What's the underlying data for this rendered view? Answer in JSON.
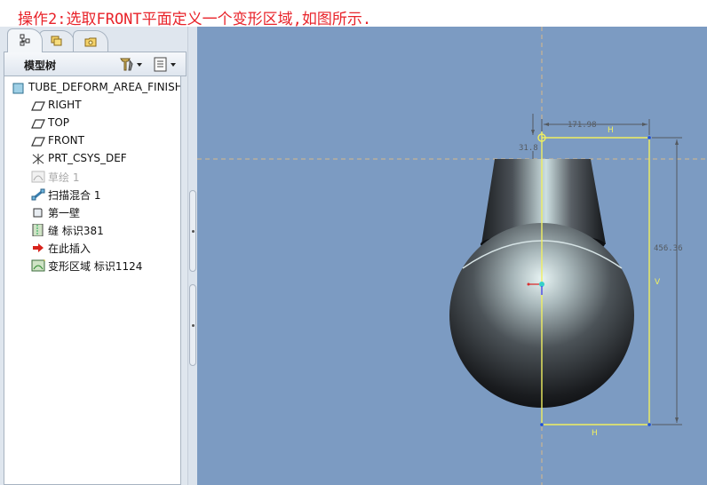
{
  "instruction": "操作2:选取FRONT平面定义一个变形区域,如图所示.",
  "tabs": [
    {
      "icon": "model-tree-tab-icon"
    },
    {
      "icon": "layers-tab-icon"
    },
    {
      "icon": "favorites-folder-tab-icon"
    }
  ],
  "model_tree": {
    "title": "模型树",
    "settings_icon": "tree-settings-tools-icon",
    "show_icon": "tree-show-list-icon",
    "items": [
      {
        "label": "TUBE_DEFORM_AREA_FINISH",
        "icon": "part-icon"
      },
      {
        "label": "RIGHT",
        "icon": "datum-plane-icon"
      },
      {
        "label": "TOP",
        "icon": "datum-plane-icon"
      },
      {
        "label": "FRONT",
        "icon": "datum-plane-icon"
      },
      {
        "label": "PRT_CSYS_DEF",
        "icon": "coordinate-system-icon"
      },
      {
        "label": "草绘 1",
        "icon": "sketch-icon"
      },
      {
        "label": "扫描混合 1",
        "icon": "swept-blend-icon"
      },
      {
        "label": "第一壁",
        "icon": "first-wall-icon"
      },
      {
        "label": "缝 标识381",
        "icon": "seam-icon"
      },
      {
        "label": "在此插入",
        "icon": "insert-here-arrow-icon"
      },
      {
        "label": "变形区域 标识1124",
        "icon": "deform-area-icon"
      }
    ]
  },
  "viewport": {
    "dimensions": {
      "width_top": "171.98",
      "offset_left": "31.8",
      "height_right": "456.36",
      "label_h_top": "H",
      "label_v": "V",
      "label_h_bottom": "H"
    }
  },
  "colors": {
    "instruction_text": "#e8232a",
    "viewport_background": "#7c9bc2",
    "sketch_lines": "#f0ef60",
    "datum_plane": "#d9b98a"
  }
}
